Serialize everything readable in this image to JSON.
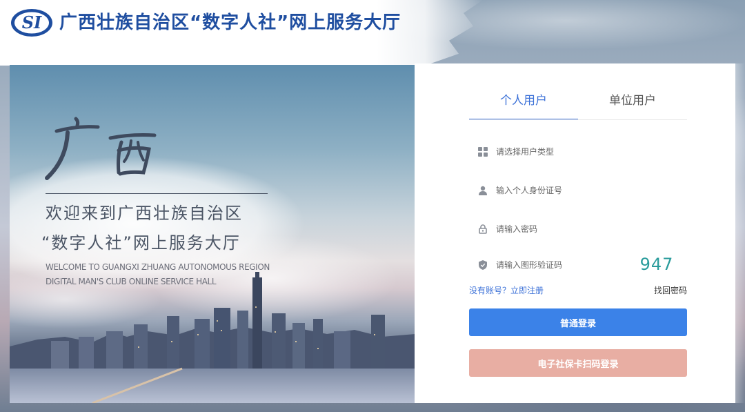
{
  "header": {
    "logo_text": "SI",
    "title": "广西壮族自治区“数字人社”网上服务大厅"
  },
  "hero": {
    "calligraphy": "广西",
    "welcome_line1": "欢迎来到广西壮族自治区",
    "welcome_line2": "“数字人社”网上服务大厅",
    "english_line1": "WELCOME TO GUANGXI ZHUANG AUTONOMOUS REGION",
    "english_line2": "DIGITAL MAN'S CLUB ONLINE SERVICE HALL"
  },
  "login": {
    "tabs": [
      {
        "label": "个人用户",
        "active": true
      },
      {
        "label": "单位用户",
        "active": false
      }
    ],
    "user_type_placeholder": "请选择用户类型",
    "id_placeholder": "输入个人身份证号",
    "password_placeholder": "请输入密码",
    "captcha_placeholder": "请输入图形验证码",
    "captcha_code": "947",
    "register_text": "没有账号？立即注册",
    "forgot_text": "找回密码",
    "login_button": "普通登录",
    "qr_login_button": "电子社保卡扫码登录"
  },
  "colors": {
    "brand_blue": "#1f4ea0",
    "accent": "#3d72d8",
    "login_button": "#3b82e8",
    "qr_button": "#e8aea3",
    "captcha": "#2a9c9c"
  },
  "icons": {
    "user_type": "grid-icon",
    "id": "user-icon",
    "password": "lock-icon",
    "captcha": "shield-icon"
  }
}
